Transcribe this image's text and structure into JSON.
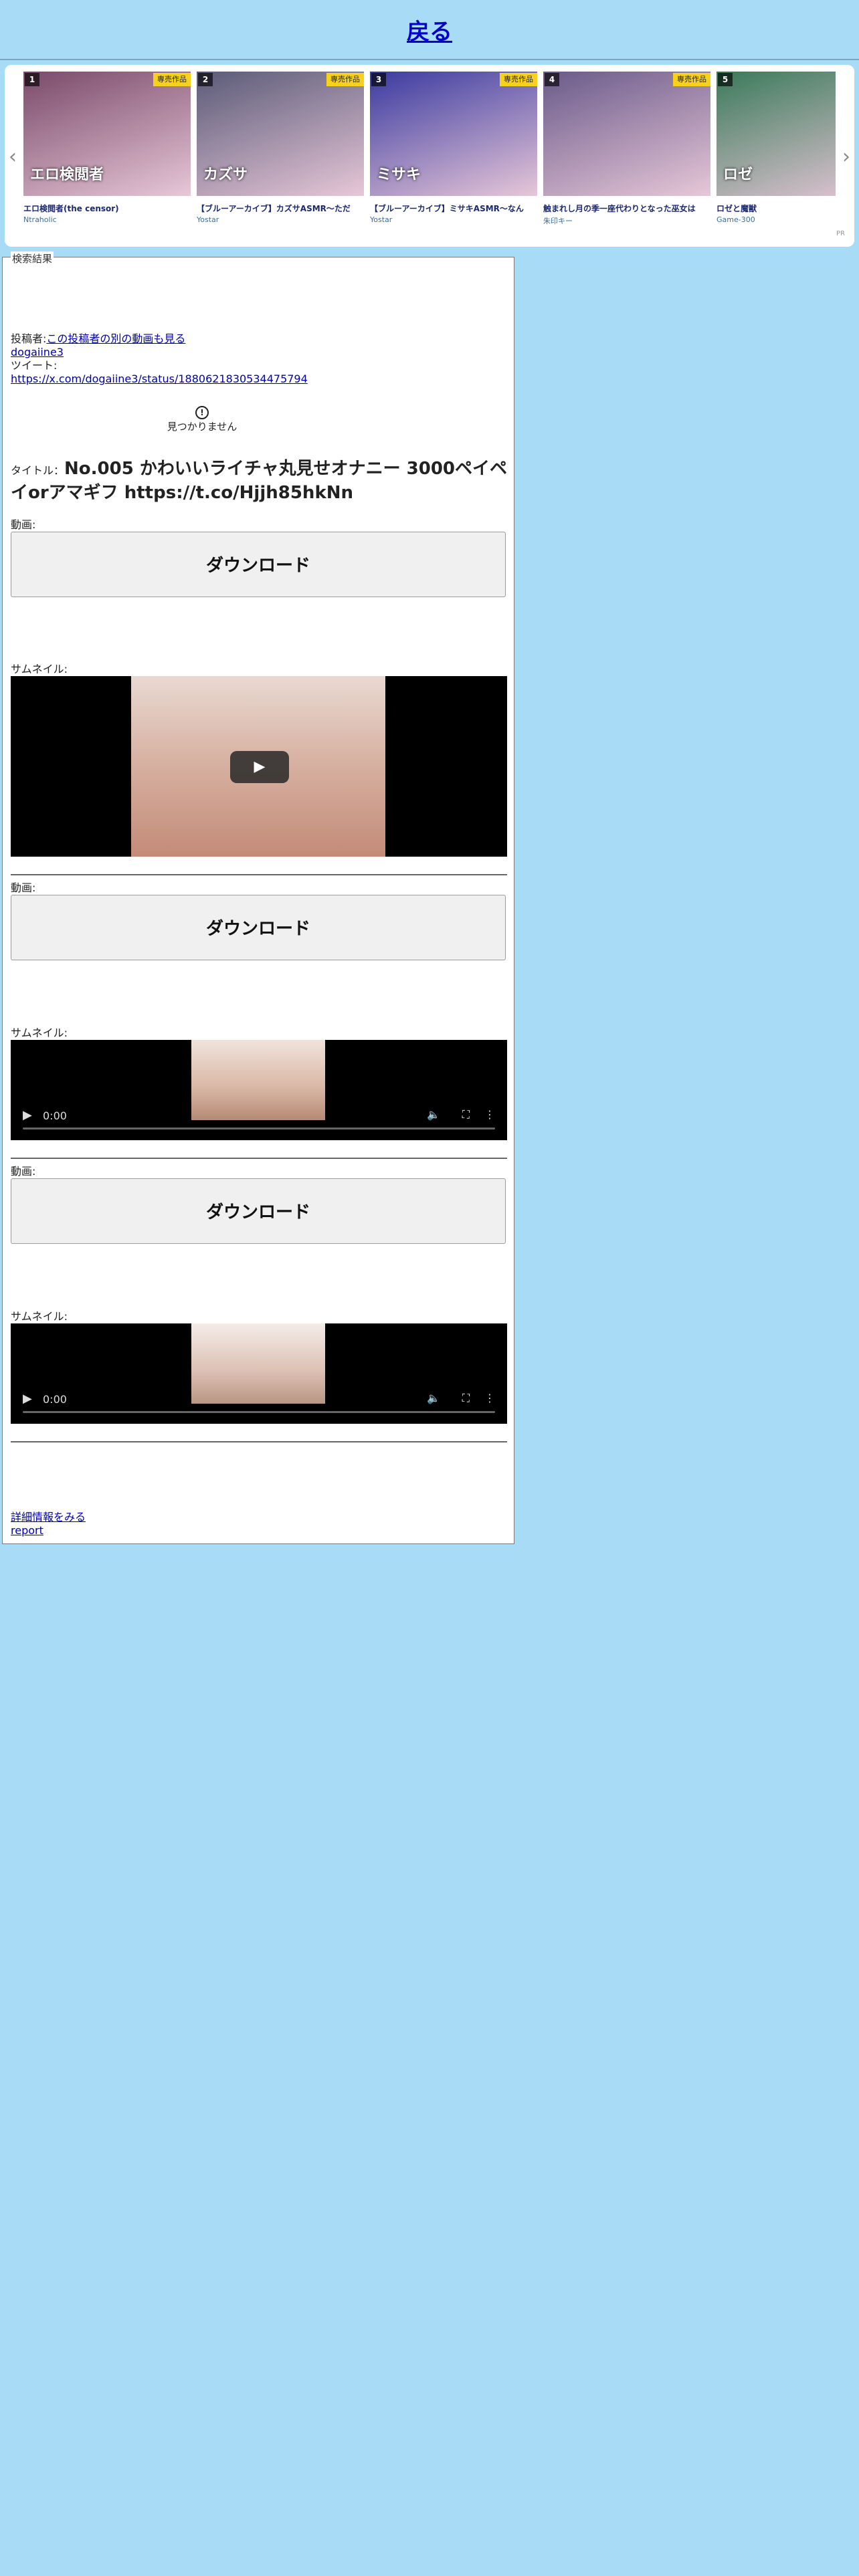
{
  "header": {
    "back_label": "戻る"
  },
  "carousel": {
    "pr_label": "PR",
    "exclusive_label": "専売作品",
    "items": [
      {
        "rank": "1",
        "title": "エロ検閲者(the censor)",
        "maker": "Ntraholic",
        "exclusive": true,
        "cover_text": "エロ検閲者",
        "color": "#7a4a6a"
      },
      {
        "rank": "2",
        "title": "【ブルーアーカイブ】カズサASMR～ただ",
        "maker": "Yostar",
        "exclusive": true,
        "cover_text": "カズサ",
        "color": "#5a5a78"
      },
      {
        "rank": "3",
        "title": "【ブルーアーカイブ】ミサキASMR～なん",
        "maker": "Yostar",
        "exclusive": true,
        "cover_text": "ミサキ",
        "color": "#3a3aa0"
      },
      {
        "rank": "4",
        "title": "触まれし月の季一座代わりとなった巫女は",
        "maker": "朱印キー",
        "exclusive": true,
        "cover_text": "",
        "color": "#6a5a8a"
      },
      {
        "rank": "5",
        "title": "ロゼと魔獣",
        "maker": "Game-300",
        "exclusive": false,
        "cover_text": "ロゼ",
        "color": "#3a7a5a"
      }
    ]
  },
  "results": {
    "legend": "検索結果",
    "poster_label": "投稿者:",
    "poster_link": "この投稿者の別の動画も見る",
    "poster_name": "dogaiine3",
    "tweet_label": "ツイート:",
    "tweet_url": "https://x.com/dogaiine3/status/1880621830534475794",
    "not_found": "見つかりません",
    "title_label": "タイトル：",
    "title": "No.005 かわいいライチャ丸見せオナニー 3000ペイペイorアマギフ https://t.co/Hjjh85hkNn",
    "videos": [
      {
        "video_label": "動画:",
        "download_label": "ダウンロード",
        "thumb_label": "サムネイル:",
        "player": "thumbnail"
      },
      {
        "video_label": "動画:",
        "download_label": "ダウンロード",
        "thumb_label": "サムネイル:",
        "player": "video",
        "time": "0:00"
      },
      {
        "video_label": "動画:",
        "download_label": "ダウンロード",
        "thumb_label": "サムネイル:",
        "player": "video",
        "time": "0:00"
      }
    ],
    "details_link": "詳細情報をみる",
    "report_link": "report"
  }
}
